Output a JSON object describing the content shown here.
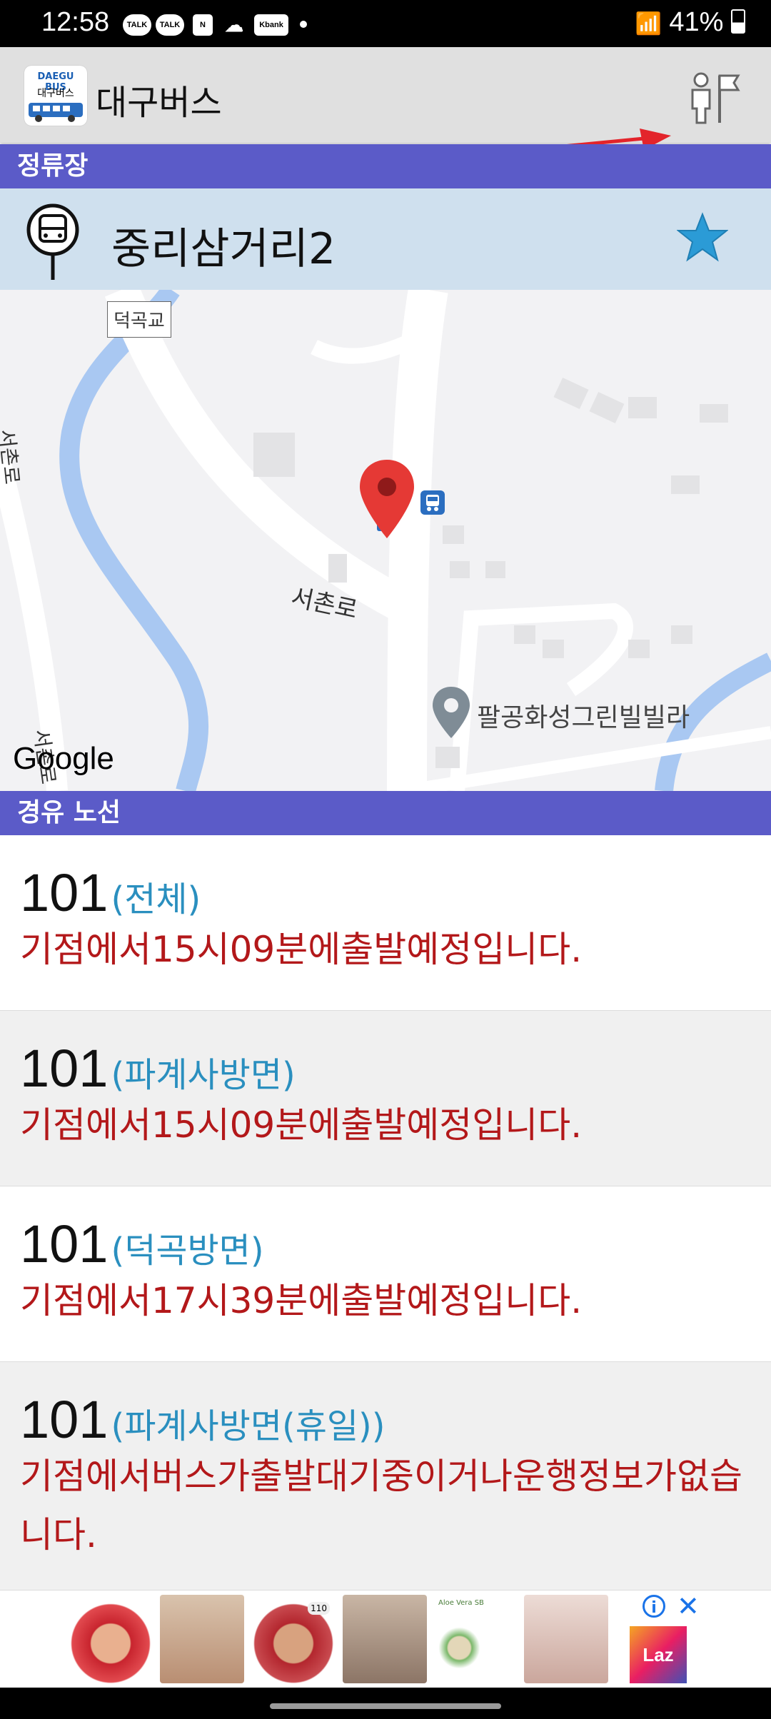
{
  "status_bar": {
    "time": "12:58",
    "notification_icons": [
      "TALK",
      "TALK",
      "N",
      "cloud",
      "Kbank"
    ],
    "battery": "41%"
  },
  "app_bar": {
    "title": "대구버스",
    "logo_text_top": "DAEGU BUS",
    "logo_text_bottom": "대구버스"
  },
  "stop_section": {
    "header": "정류장",
    "stop_name": "중리삼거리2"
  },
  "map": {
    "labels": {
      "bridge": "덕곡교",
      "road_main": "서촌로",
      "road_side": "서촌로",
      "road_left": "서촌로",
      "place": "팔공화성그린빌빌라",
      "brand": "Google"
    }
  },
  "routes_section": {
    "header": "경유 노선",
    "routes": [
      {
        "number": "101",
        "direction": "(전체)",
        "status": "기점에서15시09분에출발예정입니다."
      },
      {
        "number": "101",
        "direction": "(파계사방면)",
        "status": "기점에서15시09분에출발예정입니다."
      },
      {
        "number": "101",
        "direction": "(덕곡방면)",
        "status": "기점에서17시39분에출발예정입니다."
      },
      {
        "number": "101",
        "direction": "(파계사방면(휴일))",
        "status": "기점에서버스가출발대기중이거나운행정보가없습니다."
      }
    ]
  },
  "ad": {
    "brand": "Laz",
    "thumb_labels": [
      "Aloe Vera SB",
      "110"
    ]
  },
  "colors": {
    "section_header": "#5b5bc8",
    "stop_bar": "#cfe0ee",
    "direction_text": "#2a8fbf",
    "status_text": "#b3181a",
    "star": "#2b9bd6",
    "arrow": "#e3242b"
  }
}
